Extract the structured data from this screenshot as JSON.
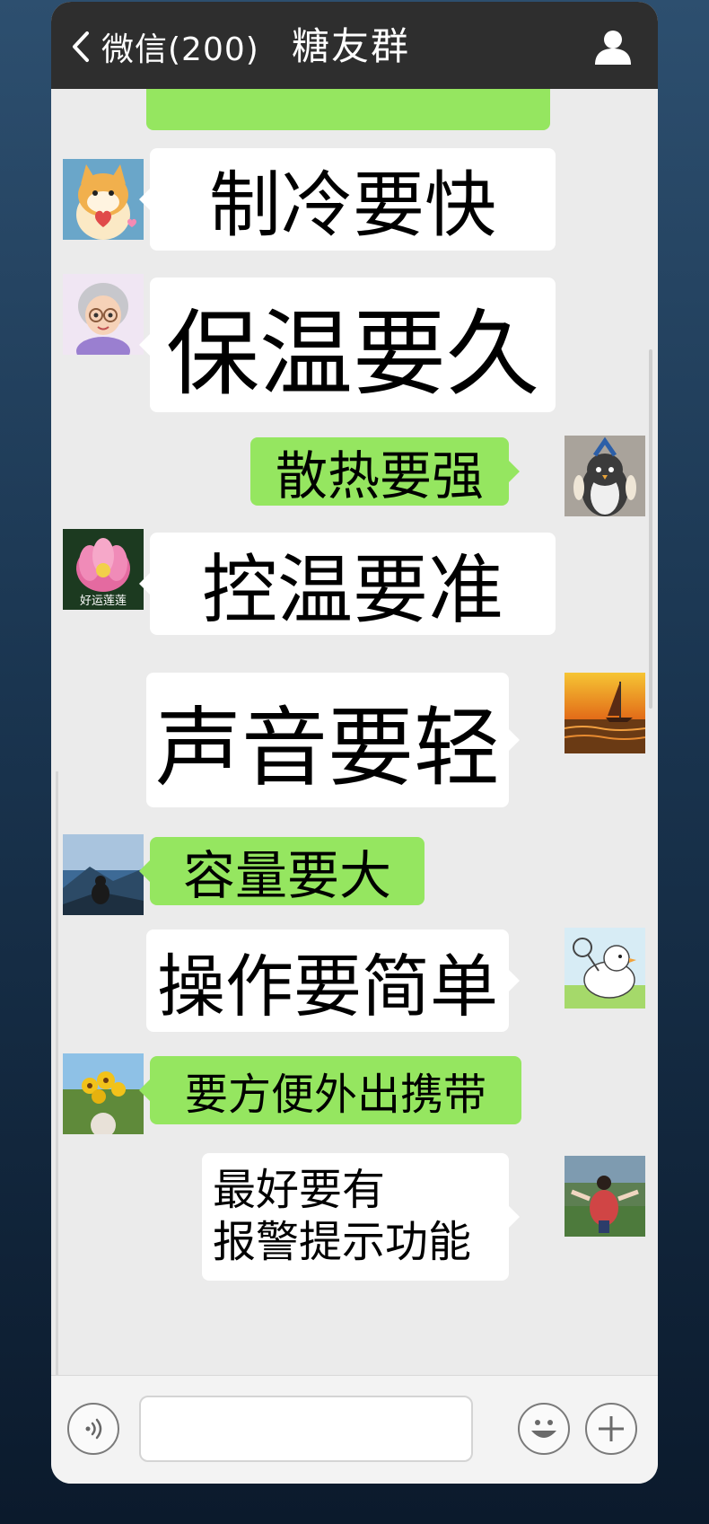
{
  "header": {
    "back_label": "微信(200)",
    "title": "糖友群",
    "right_icon": "person-icon"
  },
  "messages": [
    {
      "side": "right",
      "color": "green",
      "text": ""
    },
    {
      "side": "left",
      "avatar": "shiba-dog-avatar",
      "color": "white",
      "text": "制冷要快"
    },
    {
      "side": "left",
      "avatar": "grandma-avatar",
      "color": "white",
      "text": "保温要久"
    },
    {
      "side": "right",
      "avatar": "penguin-avatar",
      "color": "green",
      "text": "散热要强"
    },
    {
      "side": "left",
      "avatar": "lotus-avatar",
      "avatar_caption": "好运莲莲",
      "color": "white",
      "text": "控温要准"
    },
    {
      "side": "right",
      "avatar": "sailboat-sunset-avatar",
      "color": "white",
      "text": "声音要轻"
    },
    {
      "side": "left",
      "avatar": "mountain-person-avatar",
      "color": "green",
      "text": "容量要大"
    },
    {
      "side": "right",
      "avatar": "duck-tennis-avatar",
      "color": "white",
      "text": "操作要简单"
    },
    {
      "side": "left",
      "avatar": "sunflower-avatar",
      "color": "green",
      "text": "要方便外出携带"
    },
    {
      "side": "right",
      "avatar": "girl-field-avatar",
      "color": "white",
      "lines": [
        "最好要有",
        "报警提示功能"
      ]
    }
  ],
  "footer": {
    "voice_icon": "voice-icon",
    "input_value": "",
    "emoji_icon": "emoji-icon",
    "add_icon": "plus-icon"
  },
  "colors": {
    "header_bg": "#2e2e2e",
    "chat_bg": "#ebebeb",
    "green_bubble": "#95e660",
    "white_bubble": "#ffffff"
  }
}
